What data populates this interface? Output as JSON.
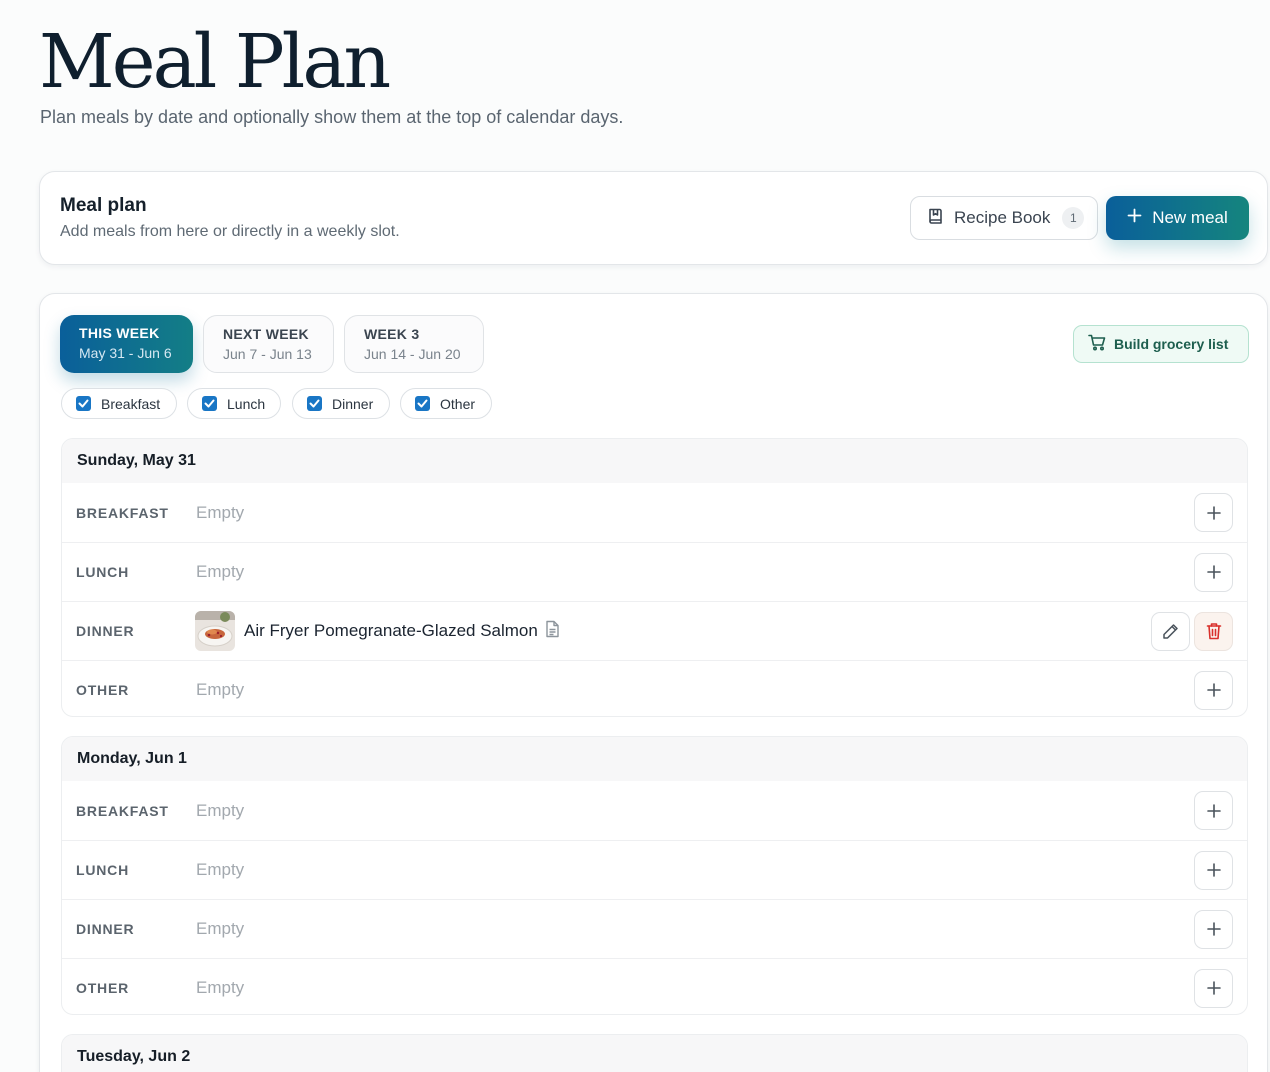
{
  "page": {
    "title": "Meal Plan",
    "subtitle": "Plan meals by date and optionally show them at the top of calendar days."
  },
  "header": {
    "title": "Meal plan",
    "description": "Add meals from here or directly in a weekly slot.",
    "recipe_book_label": "Recipe Book",
    "recipe_book_count": "1",
    "new_meal_label": "New meal"
  },
  "weeks": [
    {
      "label": "THIS WEEK",
      "range": "May 31 - Jun 6",
      "active": true
    },
    {
      "label": "NEXT WEEK",
      "range": "Jun 7 - Jun 13",
      "active": false
    },
    {
      "label": "WEEK 3",
      "range": "Jun 14 - Jun 20",
      "active": false
    }
  ],
  "grocery_label": "Build grocery list",
  "filters": [
    {
      "label": "Breakfast",
      "checked": true
    },
    {
      "label": "Lunch",
      "checked": true
    },
    {
      "label": "Dinner",
      "checked": true
    },
    {
      "label": "Other",
      "checked": true
    }
  ],
  "empty_text": "Empty",
  "days": [
    {
      "date": "Sunday, May 31",
      "slots": [
        {
          "label": "BREAKFAST",
          "meal": null
        },
        {
          "label": "LUNCH",
          "meal": null
        },
        {
          "label": "DINNER",
          "meal": "Air Fryer Pomegranate-Glazed Salmon"
        },
        {
          "label": "OTHER",
          "meal": null
        }
      ]
    },
    {
      "date": "Monday, Jun 1",
      "slots": [
        {
          "label": "BREAKFAST",
          "meal": null
        },
        {
          "label": "LUNCH",
          "meal": null
        },
        {
          "label": "DINNER",
          "meal": null
        },
        {
          "label": "OTHER",
          "meal": null
        }
      ]
    },
    {
      "date": "Tuesday, Jun 2",
      "slots": []
    }
  ],
  "colors": {
    "accent_start": "#0a5f9a",
    "accent_end": "#15857e",
    "checkbox": "#1976c5",
    "delete": "#d9302b"
  }
}
